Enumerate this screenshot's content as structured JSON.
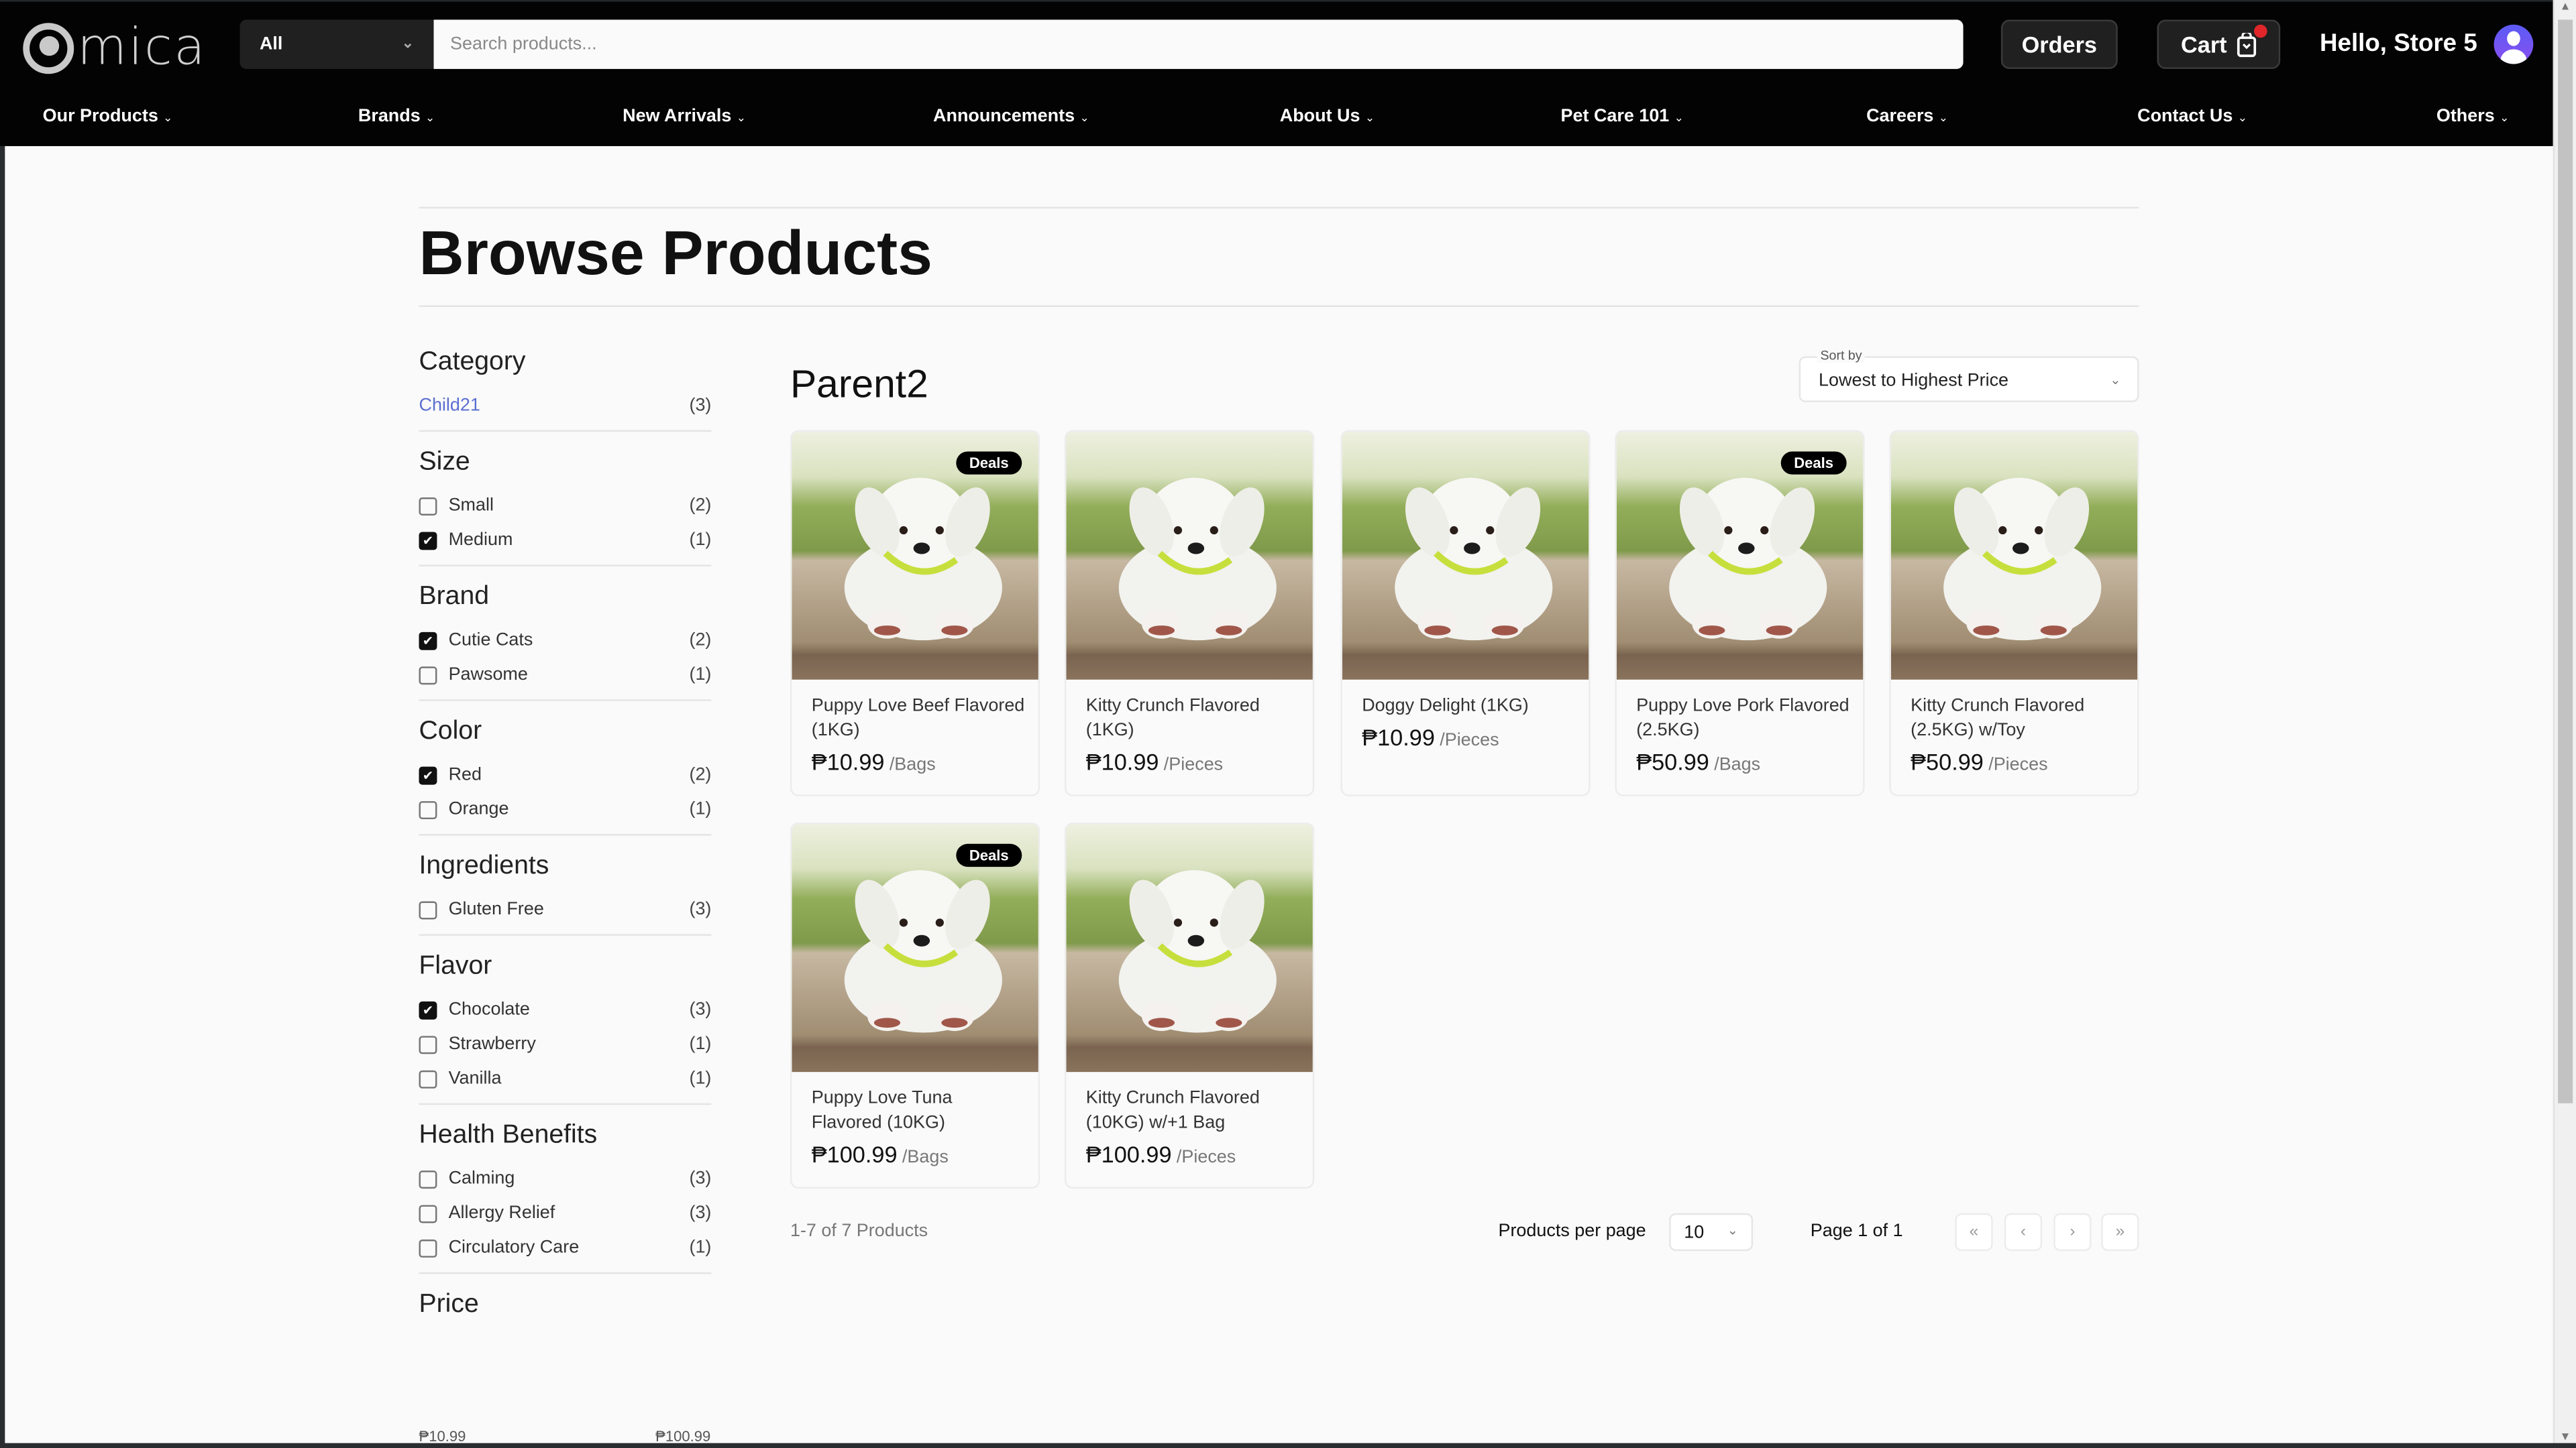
{
  "header": {
    "logo_text": "mica",
    "category_select": "All",
    "search_placeholder": "Search products...",
    "orders_label": "Orders",
    "cart_label": "Cart",
    "greeting": "Hello, Store 5"
  },
  "nav": [
    "Our Products",
    "Brands",
    "New Arrivals",
    "Announcements",
    "About Us",
    "Pet Care 101",
    "Careers",
    "Contact Us",
    "Others"
  ],
  "page_title": "Browse Products",
  "filters": [
    {
      "title": "Category",
      "items": [
        {
          "label": "Child21",
          "count": "(3)",
          "link": true
        }
      ]
    },
    {
      "title": "Size",
      "items": [
        {
          "label": "Small",
          "count": "(2)",
          "checked": false
        },
        {
          "label": "Medium",
          "count": "(1)",
          "checked": true
        }
      ]
    },
    {
      "title": "Brand",
      "items": [
        {
          "label": "Cutie Cats",
          "count": "(2)",
          "checked": true
        },
        {
          "label": "Pawsome",
          "count": "(1)",
          "checked": false
        }
      ]
    },
    {
      "title": "Color",
      "items": [
        {
          "label": "Red",
          "count": "(2)",
          "checked": true
        },
        {
          "label": "Orange",
          "count": "(1)",
          "checked": false
        }
      ]
    },
    {
      "title": "Ingredients",
      "items": [
        {
          "label": "Gluten Free",
          "count": "(3)",
          "checked": false
        }
      ]
    },
    {
      "title": "Flavor",
      "items": [
        {
          "label": "Chocolate",
          "count": "(3)",
          "checked": true
        },
        {
          "label": "Strawberry",
          "count": "(1)",
          "checked": false
        },
        {
          "label": "Vanilla",
          "count": "(1)",
          "checked": false
        }
      ]
    },
    {
      "title": "Health Benefits",
      "items": [
        {
          "label": "Calming",
          "count": "(3)",
          "checked": false
        },
        {
          "label": "Allergy Relief",
          "count": "(3)",
          "checked": false
        },
        {
          "label": "Circulatory Care",
          "count": "(1)",
          "checked": false
        }
      ]
    },
    {
      "title": "Price",
      "items": []
    }
  ],
  "price_range": {
    "min": "₱10.99",
    "max": "₱100.99"
  },
  "category_heading": "Parent2",
  "sort": {
    "label": "Sort by",
    "value": "Lowest to Highest Price"
  },
  "products": [
    {
      "name": "Puppy Love Beef Flavored (1KG)",
      "price": "₱10.99",
      "unit": "/Bags",
      "deal": "Deals"
    },
    {
      "name": "Kitty Crunch Flavored (1KG)",
      "price": "₱10.99",
      "unit": "/Pieces",
      "deal": ""
    },
    {
      "name": "Doggy Delight (1KG)",
      "price": "₱10.99",
      "unit": "/Pieces",
      "deal": ""
    },
    {
      "name": "Puppy Love Pork Flavored (2.5KG)",
      "price": "₱50.99",
      "unit": "/Bags",
      "deal": "Deals"
    },
    {
      "name": "Kitty Crunch Flavored (2.5KG) w/Toy",
      "price": "₱50.99",
      "unit": "/Pieces",
      "deal": ""
    },
    {
      "name": "Puppy Love Tuna Flavored (10KG)",
      "price": "₱100.99",
      "unit": "/Bags",
      "deal": "Deals"
    },
    {
      "name": "Kitty Crunch Flavored (10KG) w/+1 Bag",
      "price": "₱100.99",
      "unit": "/Pieces",
      "deal": ""
    }
  ],
  "pagination": {
    "count_text": "1-7 of 7 Products",
    "per_page_label": "Products per page",
    "per_page_value": "10",
    "page_text": "Page 1 of 1",
    "first": "«",
    "prev": "‹",
    "next": "›",
    "last": "»"
  }
}
